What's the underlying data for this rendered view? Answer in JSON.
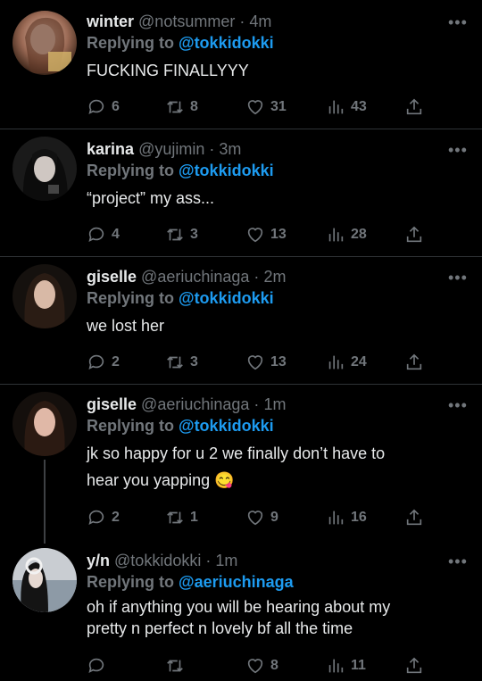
{
  "tweets": [
    {
      "name": "winter",
      "handle": "@notsummer",
      "sep": "·",
      "time": "4m",
      "reply_prefix": "Replying to",
      "reply_to": "@tokkidokki",
      "text": "FUCKING FINALLYYY",
      "text2": "",
      "replies": "6",
      "retweets": "8",
      "likes": "31",
      "views": "43",
      "avatar_icon": "user-photo"
    },
    {
      "name": "karina",
      "handle": "@yujimin",
      "sep": "·",
      "time": "3m",
      "reply_prefix": "Replying to",
      "reply_to": "@tokkidokki",
      "text": "“project” my ass...",
      "text2": "",
      "replies": "4",
      "retweets": "3",
      "likes": "13",
      "views": "28",
      "avatar_icon": "user-photo"
    },
    {
      "name": "giselle",
      "handle": "@aeriuchinaga",
      "sep": "·",
      "time": "2m",
      "reply_prefix": "Replying to",
      "reply_to": "@tokkidokki",
      "text": "we lost her",
      "text2": "",
      "replies": "2",
      "retweets": "3",
      "likes": "13",
      "views": "24",
      "avatar_icon": "user-photo"
    },
    {
      "name": "giselle",
      "handle": "@aeriuchinaga",
      "sep": "·",
      "time": "1m",
      "reply_prefix": "Replying to",
      "reply_to": "@tokkidokki",
      "text": "jk so happy for u 2 we finally don’t have to",
      "text2": "hear you yapping 😋",
      "replies": "2",
      "retweets": "1",
      "likes": "9",
      "views": "16",
      "avatar_icon": "user-photo"
    },
    {
      "name": "y/n",
      "handle": "@tokkidokki",
      "sep": "·",
      "time": "1m",
      "reply_prefix": "Replying to",
      "reply_to": "@aeriuchinaga",
      "text": "oh if anything you will be hearing about my",
      "text2": "pretty n perfect n lovely bf all the time",
      "replies": "",
      "retweets": "",
      "likes": "8",
      "views": "11",
      "avatar_icon": "user-photo"
    }
  ],
  "icons": {
    "more": "more-options-icon",
    "reply": "reply-icon",
    "retweet": "retweet-icon",
    "like": "heart-icon",
    "views": "views-icon",
    "share": "share-icon"
  },
  "colors": {
    "background": "#000000",
    "text": "#e7e9ea",
    "muted": "#71767b",
    "link": "#1d9bf0",
    "divider": "#2f3336"
  }
}
